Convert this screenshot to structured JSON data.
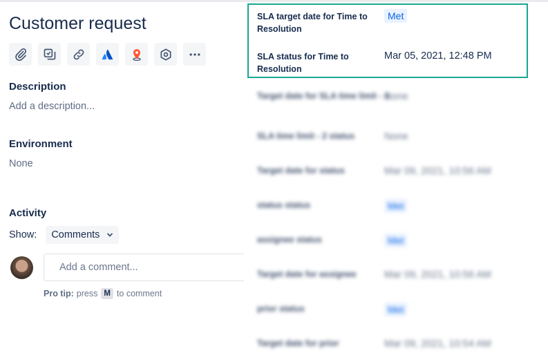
{
  "issue": {
    "title": "Customer request"
  },
  "toolbar": {
    "buttons": [
      {
        "icon": "paperclip-icon",
        "name": "attach-button"
      },
      {
        "icon": "subtask-icon",
        "name": "add-subtask-button"
      },
      {
        "icon": "link-icon",
        "name": "link-issue-button"
      },
      {
        "icon": "atlassian-icon",
        "name": "atlassian-app-button"
      },
      {
        "icon": "map-pin-icon",
        "name": "location-app-button"
      },
      {
        "icon": "hexagon-icon",
        "name": "app-extension-button"
      },
      {
        "icon": "more-icon",
        "name": "more-actions-button"
      }
    ]
  },
  "description": {
    "label": "Description",
    "placeholder": "Add a description..."
  },
  "environment": {
    "label": "Environment",
    "value": "None"
  },
  "activity": {
    "label": "Activity",
    "show_label": "Show:",
    "filter_value": "Comments",
    "comment_placeholder": "Add a comment...",
    "protip_prefix": "Pro tip:",
    "protip_press": "press",
    "protip_key": "M",
    "protip_suffix": "to comment"
  },
  "sla_fields": [
    {
      "label": "SLA target date for Time to Resolution",
      "value": "Met",
      "lozenge": true
    },
    {
      "label": "SLA status for Time to Resolution",
      "value": "Mar 05, 2021, 12:48 PM",
      "lozenge": false
    }
  ],
  "blurred_fields": [
    {
      "label": "Target date for SLA time limit - 2",
      "value": "None",
      "lozenge": false
    },
    {
      "label": "SLA time limit - 2 status",
      "value": "None",
      "lozenge": false
    },
    {
      "label": "Target date for status",
      "value": "Mar 09, 2021, 10:56 AM",
      "lozenge": false
    },
    {
      "label": "status status",
      "value": "Met",
      "lozenge": true
    },
    {
      "label": "assignee status",
      "value": "Met",
      "lozenge": true
    },
    {
      "label": "Target date for assignee",
      "value": "Mar 09, 2021, 10:56 AM",
      "lozenge": false
    },
    {
      "label": "prior status",
      "value": "Met",
      "lozenge": true
    },
    {
      "label": "Target date for prior",
      "value": "Mar 09, 2021, 10:54 AM",
      "lozenge": false
    }
  ],
  "colors": {
    "highlight_border": "#1aa68f",
    "lozenge_text": "#0c66e4",
    "lozenge_bg": "#e9f2ff"
  }
}
